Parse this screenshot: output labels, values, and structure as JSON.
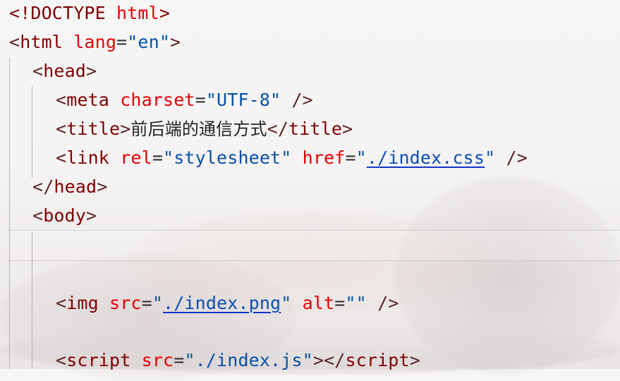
{
  "editor": {
    "lines": [
      {
        "doctype_open": "<!DOCTYPE",
        "doctype_kw": "html",
        "doctype_close": ">"
      },
      {
        "open": "<",
        "tag": "html",
        "attr": "lang",
        "eq": "=",
        "val": "\"en\"",
        "close": ">"
      },
      {
        "open": "<",
        "tag": "head",
        "close": ">"
      },
      {
        "open": "<",
        "tag": "meta",
        "attr": "charset",
        "eq": "=",
        "val": "\"UTF-8\"",
        "close": " />"
      },
      {
        "open": "<",
        "tag": "title",
        "close": ">",
        "text": "前后端的通信方式",
        "end_open": "</",
        "end_tag": "title",
        "end_close": ">"
      },
      {
        "open": "<",
        "tag": "link",
        "attr1": "rel",
        "eq1": "=",
        "val1": "\"stylesheet\"",
        "attr2": "href",
        "eq2": "=",
        "q_open": "\"",
        "link": "./index.css",
        "q_close": "\"",
        "close": " />"
      },
      {
        "open": "</",
        "tag": "head",
        "close": ">"
      },
      {
        "open": "<",
        "tag": "body",
        "close": ">"
      },
      {
        "open": "<",
        "tag": "img",
        "attr1": "src",
        "eq1": "=",
        "q_open": "\"",
        "link": "./index.png",
        "q_close": "\"",
        "attr2": "alt",
        "eq2": "=",
        "val2": "\"\"",
        "close": " />"
      },
      {
        "open": "<",
        "tag": "script",
        "attr": "src",
        "eq": "=",
        "val": "\"./index.js\"",
        "mid": "></",
        "end_tag": "script",
        "close": ">"
      }
    ]
  }
}
